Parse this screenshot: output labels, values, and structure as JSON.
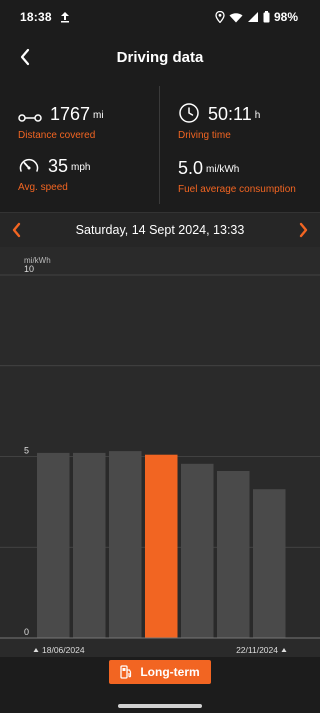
{
  "status_bar": {
    "time": "18:38",
    "battery": "98%",
    "icons": [
      "upload-icon",
      "location-icon",
      "wifi-icon",
      "signal-icon",
      "battery-icon"
    ]
  },
  "header": {
    "title": "Driving data",
    "back_icon": "chevron-left-icon"
  },
  "stats": {
    "distance": {
      "value": "1767",
      "unit": "mi",
      "label": "Distance covered",
      "icon": "distance-icon"
    },
    "time": {
      "value": "50:11",
      "unit": "h",
      "label": "Driving time",
      "icon": "clock-icon"
    },
    "speed": {
      "value": "35",
      "unit": "mph",
      "label": "Avg. speed",
      "icon": "speedometer-icon"
    },
    "consumption": {
      "value": "5.0",
      "unit": "mi/kWh",
      "label": "Fuel average consumption",
      "icon": "gauge-icon"
    }
  },
  "date_selector": {
    "text": "Saturday, 14 Sept 2024, 13:33"
  },
  "chart_data": {
    "type": "bar",
    "ylabel": "mi/kWh",
    "ylim": [
      0,
      10
    ],
    "yticks": [
      0,
      5,
      10
    ],
    "values": [
      5.1,
      5.1,
      5.15,
      5.05,
      4.8,
      4.6,
      4.1
    ],
    "highlight_index": 3,
    "x_start_label": "18/06/2024",
    "x_end_label": "22/11/2024",
    "colors": {
      "bar": "#4a4a4a",
      "highlight": "#f26522",
      "grid": "#4a4a4a"
    }
  },
  "footer": {
    "button_label": "Long-term",
    "button_icon": "fuel-pump-icon"
  },
  "colors": {
    "accent": "#f26522",
    "background": "#1c1c1c",
    "panel": "#2a2a2a"
  }
}
